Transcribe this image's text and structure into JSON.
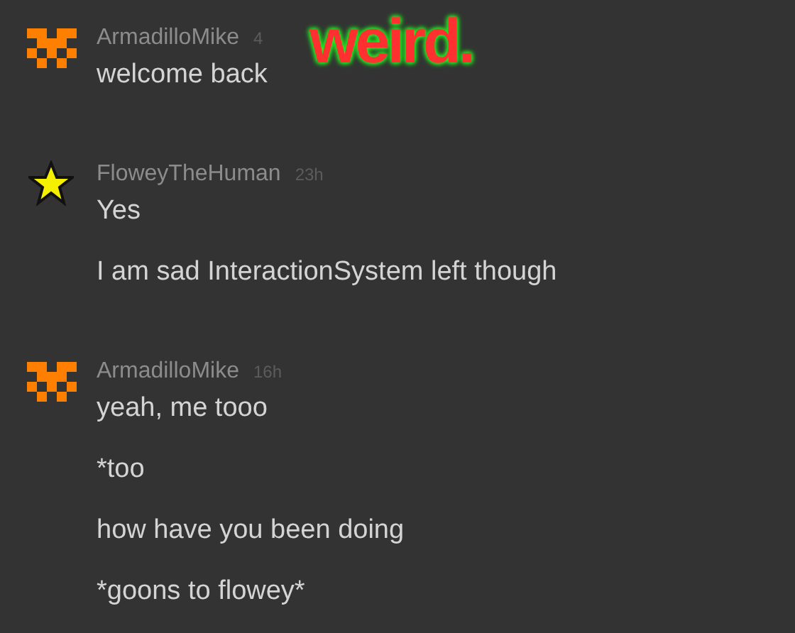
{
  "messages": [
    {
      "author": "ArmadilloMike",
      "time": "4",
      "avatar": {
        "kind": "checker"
      },
      "lines": [
        "welcome back"
      ]
    },
    {
      "author": "FloweyTheHuman",
      "time": "23h",
      "avatar": {
        "kind": "star"
      },
      "lines": [
        "Yes",
        "I am sad InteractionSystem left though"
      ]
    },
    {
      "author": "ArmadilloMike",
      "time": "16h",
      "avatar": {
        "kind": "checker"
      },
      "lines": [
        "yeah, me tooo",
        "*too",
        "how have you been doing",
        "*goons to flowey*"
      ]
    }
  ],
  "caption": {
    "text": "weird."
  }
}
